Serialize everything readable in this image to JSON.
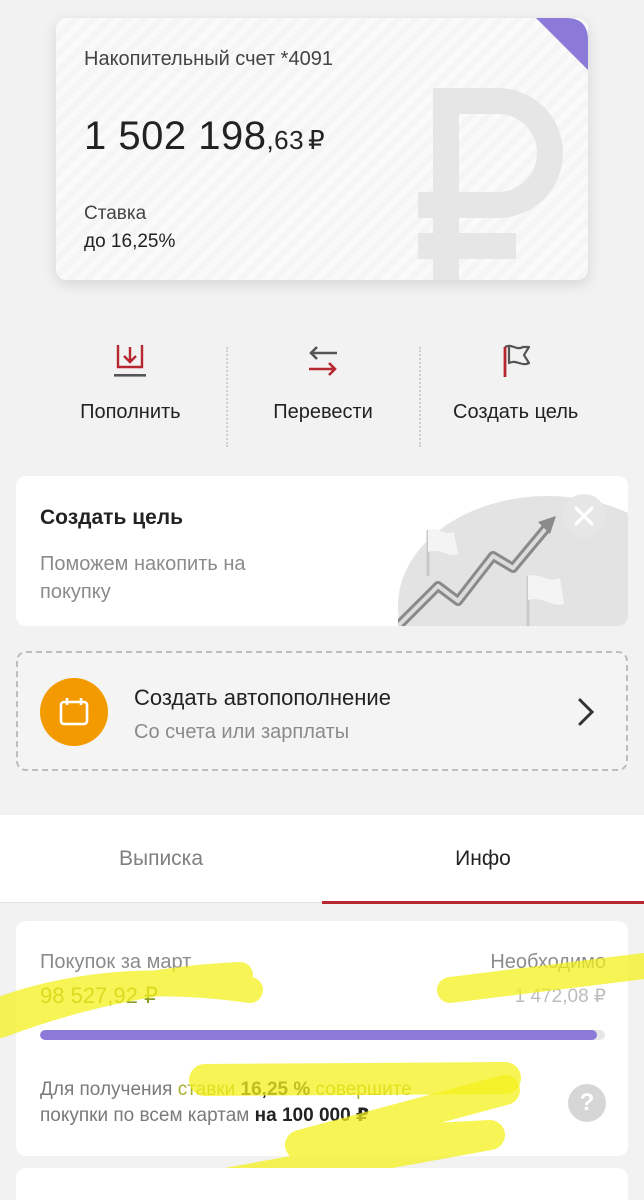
{
  "account_card": {
    "title": "Накопительный счет *4091",
    "amount_main": "1 502 198",
    "amount_cents": ",63",
    "currency": "₽",
    "rate_label": "Ставка",
    "rate_value": "до 16,25%",
    "corner_color": "#8c7ad9"
  },
  "actions": [
    {
      "label": "Пополнить",
      "icon": "deposit-icon"
    },
    {
      "label": "Перевести",
      "icon": "transfer-icon"
    },
    {
      "label": "Создать цель",
      "icon": "flag-icon"
    }
  ],
  "goal_card": {
    "title": "Создать цель",
    "text": "Поможем накопить на покупку"
  },
  "autofill": {
    "title": "Создать автопополнение",
    "subtitle": "Со счета или зарплаты"
  },
  "tabs": [
    {
      "label": "Выписка",
      "active": false
    },
    {
      "label": "Инфо",
      "active": true
    }
  ],
  "info": {
    "purchases_label": "Покупок за март",
    "purchases_value": "98 527,92 ₽",
    "required_label": "Необходимо",
    "required_value": "1 472,08 ₽",
    "progress_fraction": 0.985,
    "note_prefix": "Для получения ",
    "note_rate_word": "ставки ",
    "note_rate": "16,25 %",
    "note_action": " совершите",
    "note_line2": "покупки по всем картам ",
    "note_amount": "на 100 000 ₽",
    "accent_color": "#b7272f",
    "highlighter_color": "#f4f01c"
  }
}
